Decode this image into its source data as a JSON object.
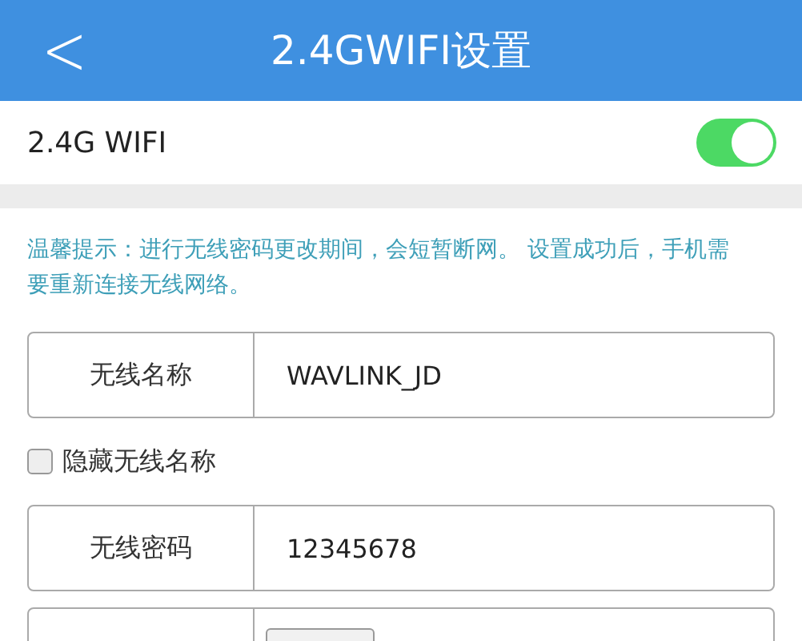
{
  "header": {
    "back": "<",
    "title": "2.4GWIFI设置"
  },
  "wifi_toggle": {
    "label": "2.4G WIFI",
    "on": true
  },
  "tip": "温馨提示：进行无线密码更改期间，会短暂断网。 设置成功后，手机需要重新连接无线网络。",
  "fields": [
    {
      "label": "无线名称",
      "value": "WAVLINK_JD"
    }
  ],
  "hide_ssid": {
    "label": "隐藏无线名称",
    "checked": false
  },
  "password_field": {
    "label": "无线密码",
    "value": "12345678"
  }
}
